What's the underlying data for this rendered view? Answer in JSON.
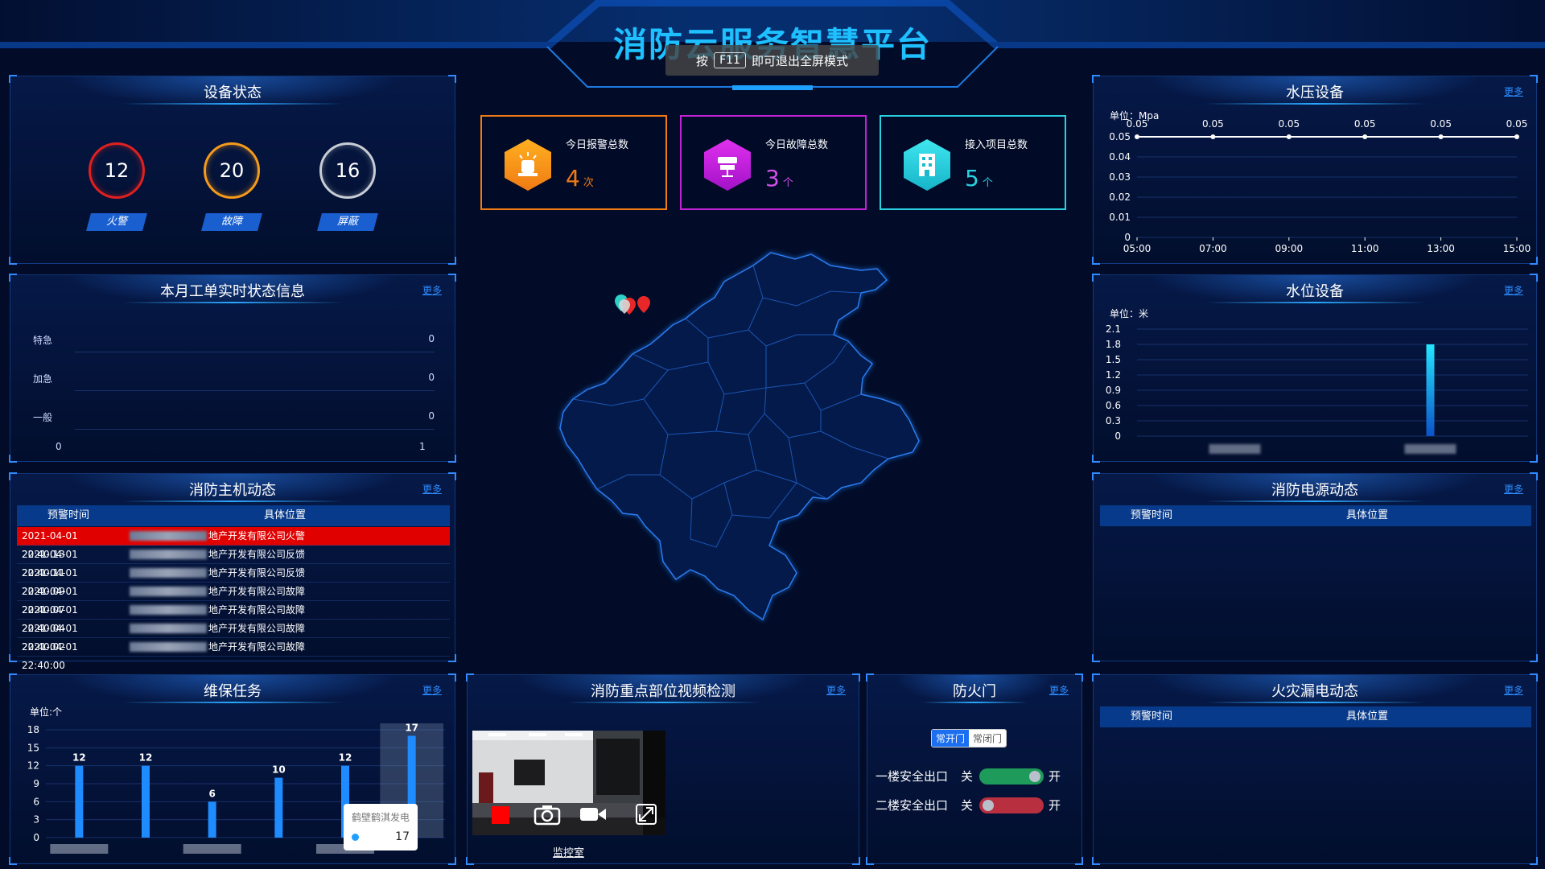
{
  "header": {
    "title": "消防云服务智慧平台",
    "fullscreen_notice": {
      "prefix": "按",
      "key": "F11",
      "suffix": "即可退出全屏模式"
    }
  },
  "device_status": {
    "title": "设备状态",
    "items": [
      {
        "value": "12",
        "label": "火警",
        "color": "#e02020"
      },
      {
        "value": "20",
        "label": "故障",
        "color": "#f59a1b"
      },
      {
        "value": "16",
        "label": "屏蔽",
        "color": "#c8ccd4"
      }
    ]
  },
  "work_orders": {
    "title": "本月工单实时状态信息",
    "more": "更多",
    "rows": [
      {
        "label": "特急",
        "value": "0"
      },
      {
        "label": "加急",
        "value": "0"
      },
      {
        "label": "一般",
        "value": "0"
      }
    ],
    "axis": [
      "0",
      "1"
    ]
  },
  "host_dynamics": {
    "title": "消防主机动态",
    "more": "更多",
    "headers": [
      "预警时间",
      "具体位置"
    ],
    "rows": [
      {
        "time": "2021-04-01 22:40:13",
        "location": "地产开发有限公司火警",
        "alarm": true
      },
      {
        "time": "2021-04-01 22:40:11",
        "location": "地产开发有限公司反馈",
        "alarm": false
      },
      {
        "time": "2021-04-01 22:40:09",
        "location": "地产开发有限公司反馈",
        "alarm": false
      },
      {
        "time": "2021-04-01 22:40:07",
        "location": "地产开发有限公司故障",
        "alarm": false
      },
      {
        "time": "2021-04-01 22:40:04",
        "location": "地产开发有限公司故障",
        "alarm": false
      },
      {
        "time": "2021-04-01 22:40:02",
        "location": "地产开发有限公司故障",
        "alarm": false
      },
      {
        "time": "2021-04-01 22:40:00",
        "location": "地产开发有限公司故障",
        "alarm": false
      }
    ]
  },
  "stats": [
    {
      "label": "今日报警总数",
      "value": "4",
      "unit": "次",
      "color": "#f07a14"
    },
    {
      "label": "今日故障总数",
      "value": "3",
      "unit": "个",
      "color": "#c022d8"
    },
    {
      "label": "接入项目总数",
      "value": "5",
      "unit": "个",
      "color": "#2ad0e0"
    }
  ],
  "water_pressure": {
    "title": "水压设备",
    "more": "更多",
    "chart_data": {
      "type": "line",
      "unit": "单位：Mpa",
      "x": [
        "05:00",
        "07:00",
        "09:00",
        "11:00",
        "13:00",
        "15:00"
      ],
      "values": [
        0.05,
        0.05,
        0.05,
        0.05,
        0.05,
        0.05
      ],
      "y_ticks": [
        "0.05",
        "0.04",
        "0.03",
        "0.02",
        "0.01",
        "0"
      ],
      "ylim": [
        0,
        0.05
      ]
    }
  },
  "water_level": {
    "title": "水位设备",
    "more": "更多",
    "chart_data": {
      "type": "bar",
      "unit": "单位：米",
      "values": [
        0,
        1.8
      ],
      "y_ticks": [
        "2.1",
        "1.8",
        "1.5",
        "1.2",
        "0.9",
        "0.6",
        "0.3",
        "0"
      ],
      "ylim": [
        0,
        2.1
      ]
    }
  },
  "power_dynamics": {
    "title": "消防电源动态",
    "more": "更多",
    "headers": [
      "预警时间",
      "具体位置"
    ]
  },
  "maintenance": {
    "title": "维保任务",
    "more": "更多",
    "chart_data": {
      "type": "bar",
      "unit": "单位:个",
      "values": [
        12,
        12,
        6,
        10,
        12,
        17
      ],
      "y_ticks": [
        "18",
        "15",
        "12",
        "9",
        "6",
        "3",
        "0"
      ],
      "ylim": [
        0,
        18
      ]
    },
    "tooltip": {
      "name": "鹤壁鹤淇发电",
      "value": "17"
    }
  },
  "video": {
    "title": "消防重点部位视频检测",
    "more": "更多",
    "camera_label": "监控室"
  },
  "fire_door": {
    "title": "防火门",
    "more": "更多",
    "tabs": [
      "常开门",
      "常闭门"
    ],
    "doors": [
      {
        "name": "一楼安全出口",
        "off": "关",
        "on": "开",
        "state": "on"
      },
      {
        "name": "二楼安全出口",
        "off": "关",
        "on": "开",
        "state": "off"
      }
    ]
  },
  "leakage": {
    "title": "火灾漏电动态",
    "more": "更多",
    "headers": [
      "预警时间",
      "具体位置"
    ]
  }
}
